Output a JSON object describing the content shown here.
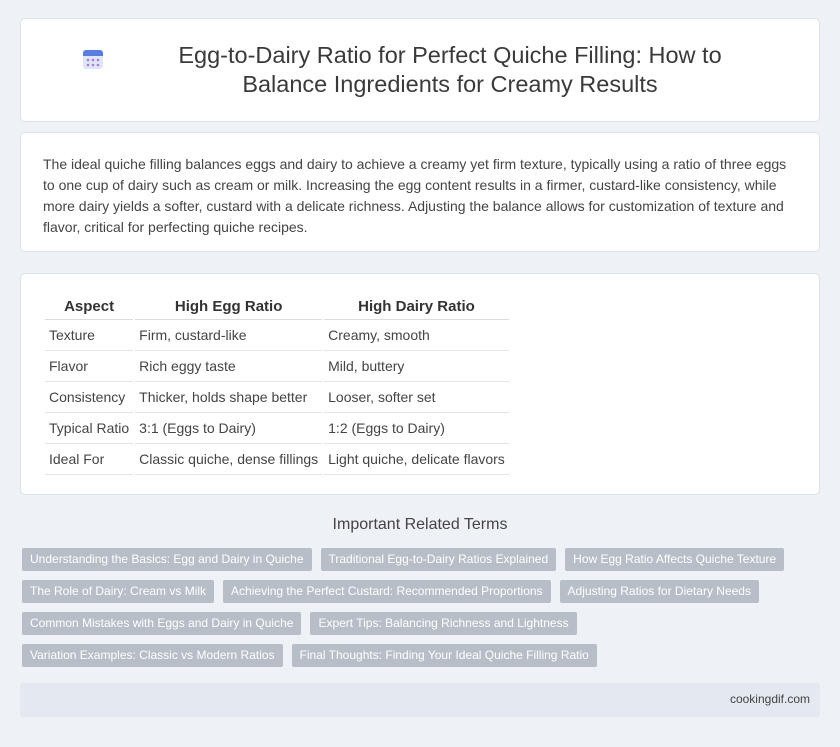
{
  "header": {
    "title": "Egg-to-Dairy Ratio for Perfect Quiche Filling: How to Balance Ingredients for Creamy Results",
    "icon": "calendar-icon"
  },
  "intro": {
    "text": "The ideal quiche filling balances eggs and dairy to achieve a creamy yet firm texture, typically using a ratio of three eggs to one cup of dairy such as cream or milk. Increasing the egg content results in a firmer, custard-like consistency, while more dairy yields a softer, custard with a delicate richness. Adjusting the balance allows for customization of texture and flavor, critical for perfecting quiche recipes."
  },
  "table": {
    "headers": [
      "Aspect",
      "High Egg Ratio",
      "High Dairy Ratio"
    ],
    "rows": [
      [
        "Texture",
        "Firm, custard-like",
        "Creamy, smooth"
      ],
      [
        "Flavor",
        "Rich eggy taste",
        "Mild, buttery"
      ],
      [
        "Consistency",
        "Thicker, holds shape better",
        "Looser, softer set"
      ],
      [
        "Typical Ratio",
        "3:1 (Eggs to Dairy)",
        "1:2 (Eggs to Dairy)"
      ],
      [
        "Ideal For",
        "Classic quiche, dense fillings",
        "Light quiche, delicate flavors"
      ]
    ]
  },
  "related": {
    "title": "Important Related Terms",
    "rows": [
      [
        "Understanding the Basics: Egg and Dairy in Quiche",
        "Traditional Egg-to-Dairy Ratios Explained",
        "How Egg Ratio Affects Quiche Texture"
      ],
      [
        "The Role of Dairy: Cream vs Milk",
        "Achieving the Perfect Custard: Recommended Proportions",
        "Adjusting Ratios for Dietary Needs"
      ],
      [
        "Common Mistakes with Eggs and Dairy in Quiche",
        "Expert Tips: Balancing Richness and Lightness"
      ],
      [
        "Variation Examples: Classic vs Modern Ratios",
        "Final Thoughts: Finding Your Ideal Quiche Filling Ratio"
      ]
    ]
  },
  "footer": {
    "site": "cookingdif.com"
  }
}
